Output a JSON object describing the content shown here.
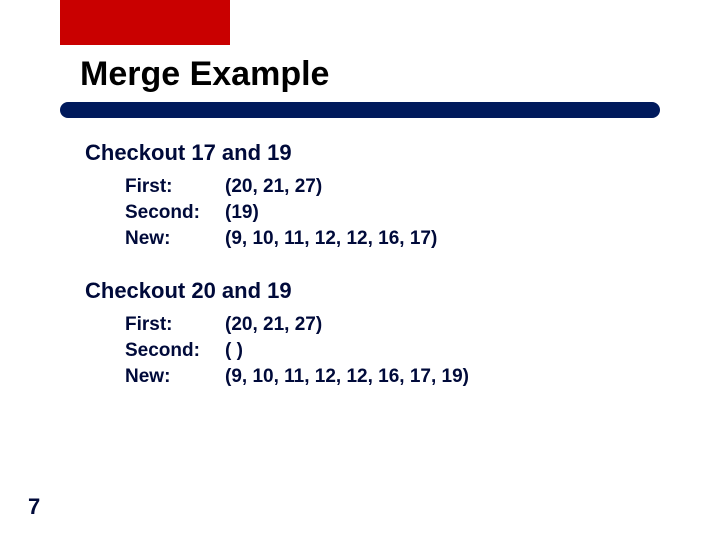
{
  "title": "Merge Example",
  "slide_number": "7",
  "steps": [
    {
      "header": "Checkout 17 and 19",
      "rows": [
        {
          "label": "First:",
          "value": "(20, 21, 27)"
        },
        {
          "label": "Second:",
          "value": "(19)"
        },
        {
          "label": "New:",
          "value": "(9, 10, 11, 12, 12, 16, 17)"
        }
      ]
    },
    {
      "header": "Checkout 20 and 19",
      "rows": [
        {
          "label": "First:",
          "value": "(20, 21, 27)"
        },
        {
          "label": "Second:",
          "value": "( )"
        },
        {
          "label": "New:",
          "value": "(9, 10, 11, 12, 12, 16, 17, 19)"
        }
      ]
    }
  ]
}
